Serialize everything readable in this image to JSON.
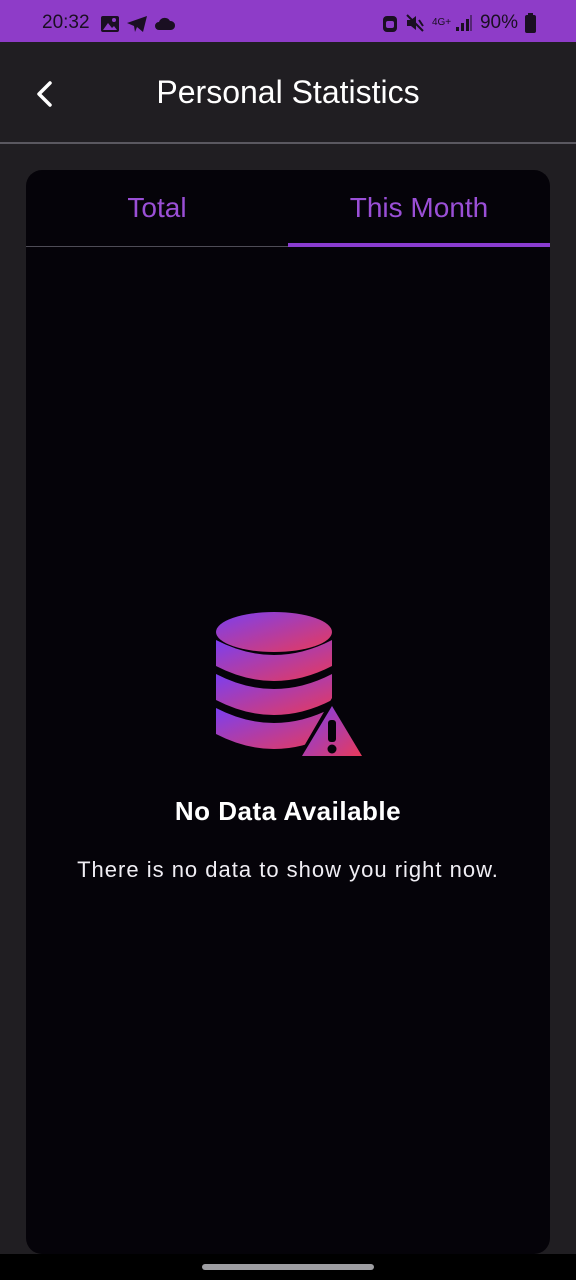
{
  "status_bar": {
    "time": "20:32",
    "network": "4G+",
    "battery": "90%"
  },
  "header": {
    "title": "Personal Statistics"
  },
  "tabs": [
    {
      "label": "Total",
      "selected": false
    },
    {
      "label": "This Month",
      "selected": true
    }
  ],
  "empty_state": {
    "title": "No Data Available",
    "message": "There is no data to show you right now."
  },
  "colors": {
    "accent": "#8a3cd0",
    "status_bar": "#8e3cc8",
    "background": "#201e22",
    "card": "#050309",
    "gradient_start": "#7b3ff0",
    "gradient_end": "#e83a5a"
  }
}
